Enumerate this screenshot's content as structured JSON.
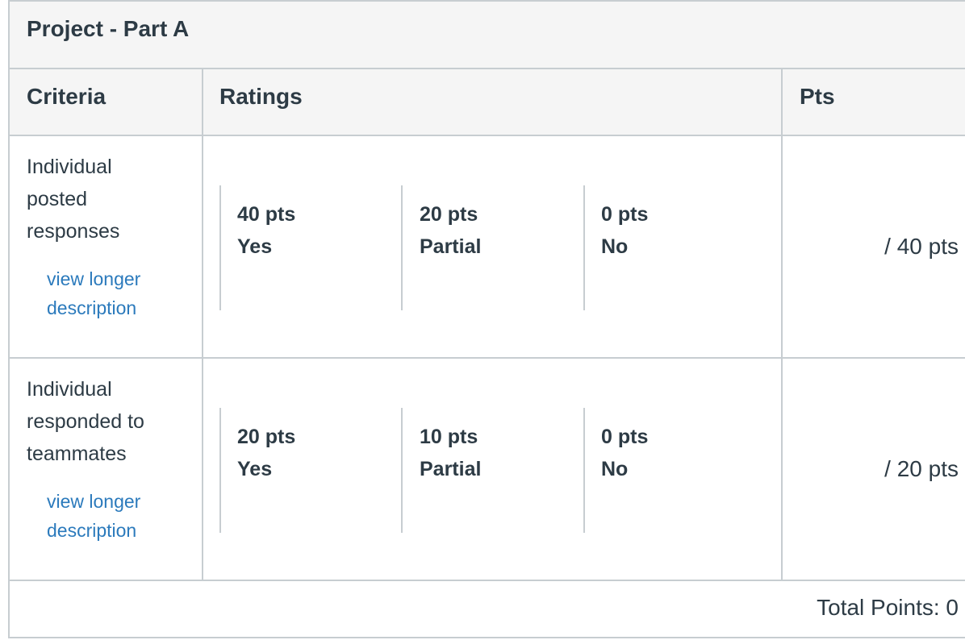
{
  "title": "Project - Part A",
  "headers": {
    "criteria": "Criteria",
    "ratings": "Ratings",
    "pts": "Pts"
  },
  "rows": [
    {
      "criterion": [
        "Individual",
        "posted",
        "responses"
      ],
      "link": [
        "view longer",
        "description"
      ],
      "ratings": [
        {
          "points": "40 pts",
          "label": "Yes"
        },
        {
          "points": "20 pts",
          "label": "Partial"
        },
        {
          "points": "0 pts",
          "label": "No"
        }
      ],
      "pts": "/ 40 pts"
    },
    {
      "criterion": [
        "Individual",
        "responded to",
        "teammates"
      ],
      "link": [
        "view longer",
        "description"
      ],
      "ratings": [
        {
          "points": "20 pts",
          "label": "Yes"
        },
        {
          "points": "10 pts",
          "label": "Partial"
        },
        {
          "points": "0 pts",
          "label": "No"
        }
      ],
      "pts": "/ 20 pts"
    }
  ],
  "total": "Total Points: 0"
}
